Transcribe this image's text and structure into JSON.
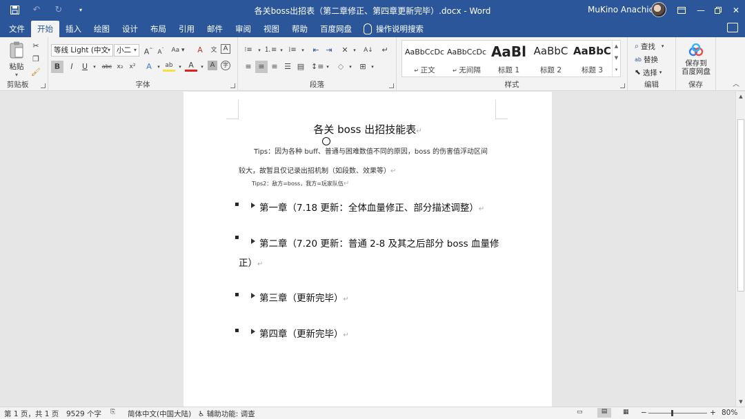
{
  "window": {
    "title": "各关boss出招表（第二章修正、第四章更新完毕）.docx  -  Word",
    "user": "MuKino Anachico"
  },
  "qat": {
    "save_icon": "save-icon",
    "undo_icon": "undo-icon",
    "redo_icon": "redo-icon",
    "customize_icon": "customize-qat-icon"
  },
  "tabs": [
    "文件",
    "开始",
    "插入",
    "绘图",
    "设计",
    "布局",
    "引用",
    "邮件",
    "审阅",
    "视图",
    "帮助",
    "百度网盘"
  ],
  "active_tab": "开始",
  "tellme": "操作说明搜索",
  "ribbon": {
    "clipboard": {
      "label": "剪贴板",
      "paste": "粘贴"
    },
    "font": {
      "label": "字体",
      "font_name": "等线 Light (中文",
      "font_size": "小二",
      "bold": "B",
      "italic": "I",
      "underline": "U",
      "strike": "abc",
      "subscript": "x₂",
      "superscript": "x²",
      "grow": "A",
      "shrink": "A",
      "case": "Aa",
      "clear": "A",
      "phonetic": "文",
      "border_char": "A",
      "text_effect": "A",
      "highlight": "ab",
      "font_color": "A",
      "shading": "A",
      "enclose": "字"
    },
    "paragraph": {
      "label": "段落"
    },
    "styles": {
      "label": "样式",
      "items": [
        {
          "sample": "AaBbCcDc",
          "name": "正文"
        },
        {
          "sample": "AaBbCcDc",
          "name": "无间隔"
        },
        {
          "sample": "AaBl",
          "name": "标题 1"
        },
        {
          "sample": "AaBbC",
          "name": "标题 2"
        },
        {
          "sample": "AaBbC",
          "name": "标题 3"
        }
      ]
    },
    "editing": {
      "label": "编辑",
      "find": "查找",
      "replace": "替换",
      "select": "选择"
    },
    "save": {
      "label": "保存",
      "button": "保存到\n百度网盘",
      "line1": "保存到",
      "line2": "百度网盘"
    }
  },
  "document": {
    "title": "各关 boss 出招技能表",
    "tips_line1": "Tips：因为各种 buff、普通与困难数值不同的原因，boss 的伤害值浮动区间",
    "tips_line2": "较大，故暂且仅记录出招机制（如段数、效果等）",
    "tips2": "Tips2：敌方=boss，我方=玩家队伍",
    "chapters": [
      {
        "text": "第一章（7.18 更新：全体血量修正、部分描述调整）"
      },
      {
        "text": "第二章（7.20 更新：普通 2-8 及其之后部分 boss 血量修",
        "text2": "正）"
      },
      {
        "text": "第三章（更新完毕）"
      },
      {
        "text": "第四章（更新完毕）"
      }
    ],
    "pilcrow": "↵"
  },
  "status": {
    "page": "第 1 页，共 1 页",
    "words": "9529 个字",
    "language": "简体中文(中国大陆)",
    "accessibility": "辅助功能: 调查",
    "zoom": "80%"
  }
}
